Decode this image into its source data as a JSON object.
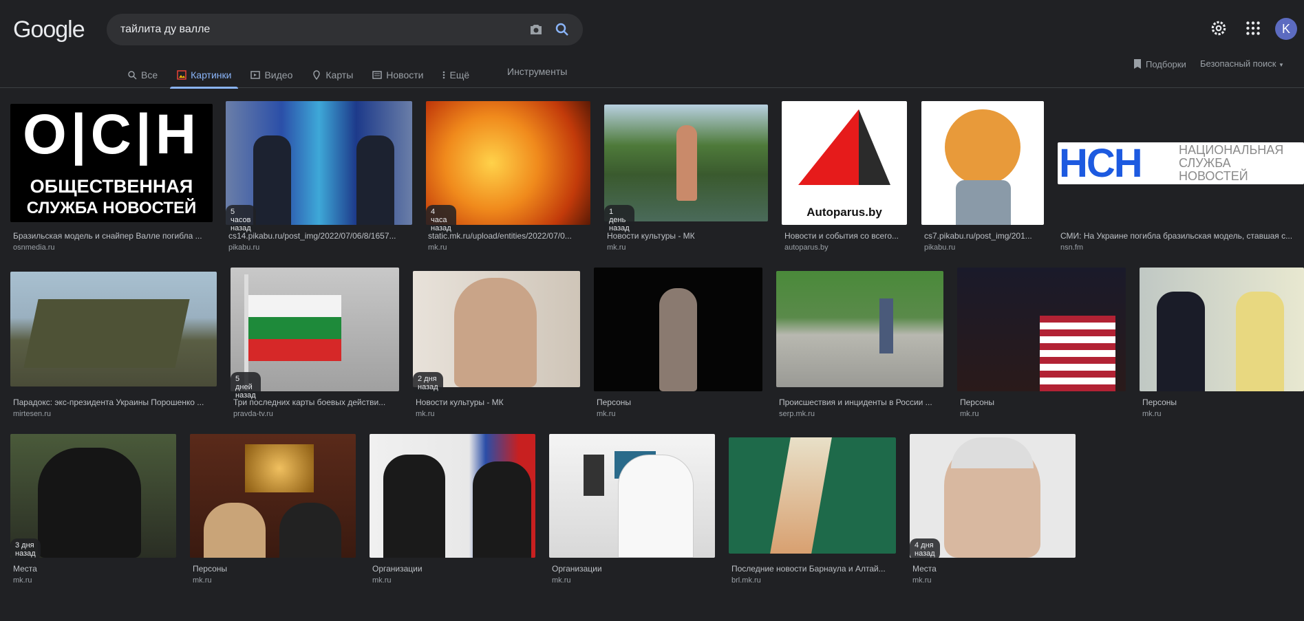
{
  "brand": "Google",
  "search": {
    "query": "тайлита ду валле"
  },
  "header": {
    "avatar_letter": "K"
  },
  "tabs": [
    {
      "label": "Все",
      "icon": "search-icon"
    },
    {
      "label": "Картинки",
      "icon": "images-icon"
    },
    {
      "label": "Видео",
      "icon": "video-icon"
    },
    {
      "label": "Карты",
      "icon": "map-pin-icon"
    },
    {
      "label": "Новости",
      "icon": "news-icon"
    },
    {
      "label": "Ещё",
      "icon": "more-vert-icon"
    }
  ],
  "tools_label": "Инструменты",
  "collections_label": "Подборки",
  "safesearch_label": "Безопасный поиск",
  "results": [
    {
      "title": "Бразильская модель и снайпер Валле погибла ...",
      "source": "osnmedia.ru",
      "badge": ""
    },
    {
      "title": "cs14.pikabu.ru/post_img/2022/07/06/8/1657...",
      "source": "pikabu.ru",
      "badge": "5 часов назад"
    },
    {
      "title": "static.mk.ru/upload/entities/2022/07/0...",
      "source": "mk.ru",
      "badge": "4 часа назад"
    },
    {
      "title": "Новости культуры - МК",
      "source": "mk.ru",
      "badge": "1 день назад"
    },
    {
      "title": "Новости и события со всего...",
      "source": "autoparus.by",
      "badge": ""
    },
    {
      "title": "cs7.pikabu.ru/post_img/201...",
      "source": "pikabu.ru",
      "badge": ""
    },
    {
      "title": "СМИ: На Украине погибла бразильская модель, ставшая с...",
      "source": "nsn.fm",
      "badge": ""
    },
    {
      "title": "Парадокс: экс-президента Украины Порошенко ...",
      "source": "mirtesen.ru",
      "badge": ""
    },
    {
      "title": "Три последних карты боевых действи...",
      "source": "pravda-tv.ru",
      "badge": "5 дней назад"
    },
    {
      "title": "Новости культуры - МК",
      "source": "mk.ru",
      "badge": "2 дня назад"
    },
    {
      "title": "Персоны",
      "source": "mk.ru",
      "badge": ""
    },
    {
      "title": "Происшествия и инциденты в России ...",
      "source": "serp.mk.ru",
      "badge": ""
    },
    {
      "title": "Персоны",
      "source": "mk.ru",
      "badge": ""
    },
    {
      "title": "Персоны",
      "source": "mk.ru",
      "badge": ""
    },
    {
      "title": "Места",
      "source": "mk.ru",
      "badge": "3 дня назад"
    },
    {
      "title": "Персоны",
      "source": "mk.ru",
      "badge": ""
    },
    {
      "title": "Организации",
      "source": "mk.ru",
      "badge": ""
    },
    {
      "title": "Организации",
      "source": "mk.ru",
      "badge": ""
    },
    {
      "title": "Последние новости Барнаула и Алтай...",
      "source": "brl.mk.ru",
      "badge": ""
    },
    {
      "title": "Места",
      "source": "mk.ru",
      "badge": "4 дня назад"
    }
  ],
  "image_text": {
    "osn_big": "О|С|Н",
    "osn_line1": "ОБЩЕСТВЕННАЯ",
    "osn_line2": "СЛУЖБА НОВОСТЕЙ",
    "autoparus": "Autoparus.by",
    "nsn_logo": "НСН",
    "nsn_line1": "НАЦИОНАЛЬНАЯ",
    "nsn_line2": "СЛУЖБА",
    "nsn_line3": "НОВОСТЕЙ"
  },
  "colors": {
    "bg": "#202124",
    "accent": "#8ab4f8",
    "search_bg": "#303134"
  }
}
